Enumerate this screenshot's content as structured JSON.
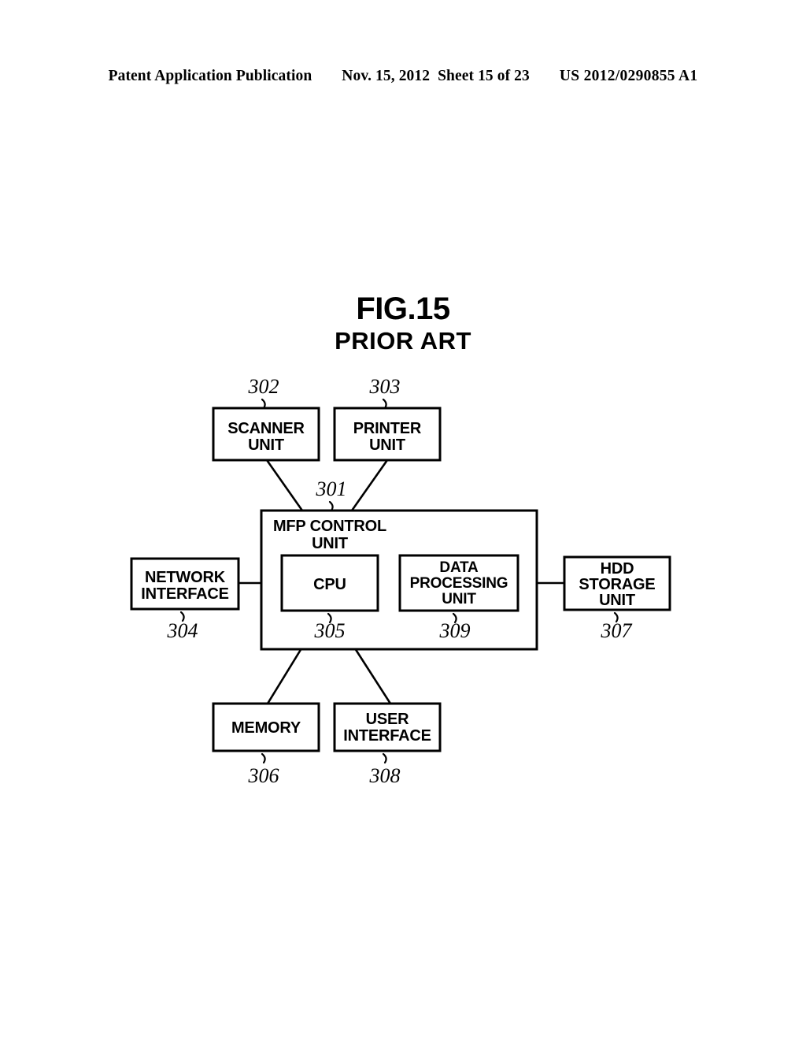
{
  "header": {
    "publication": "Patent Application Publication",
    "date": "Nov. 15, 2012",
    "sheet": "Sheet 15 of 23",
    "patent_number": "US 2012/0290855 A1"
  },
  "figure": {
    "title": "FIG.15",
    "subtitle": "PRIOR ART"
  },
  "diagram": {
    "type": "block-diagram",
    "blocks": {
      "scanner": {
        "ref": "302",
        "line1": "SCANNER",
        "line2": "UNIT"
      },
      "printer": {
        "ref": "303",
        "line1": "PRINTER",
        "line2": "UNIT"
      },
      "mfp": {
        "ref": "301",
        "line1": "MFP CONTROL",
        "line2": "UNIT"
      },
      "cpu": {
        "ref": "305",
        "line1": "CPU"
      },
      "dpu": {
        "ref": "309",
        "line1": "DATA",
        "line2": "PROCESSING",
        "line3": "UNIT"
      },
      "network": {
        "ref": "304",
        "line1": "NETWORK",
        "line2": "INTERFACE"
      },
      "hdd": {
        "ref": "307",
        "line1": "HDD",
        "line2": "STORAGE",
        "line3": "UNIT"
      },
      "memory": {
        "ref": "306",
        "line1": "MEMORY"
      },
      "userinterface": {
        "ref": "308",
        "line1": "USER",
        "line2": "INTERFACE"
      }
    },
    "colors": {
      "stroke": "#000000",
      "fill": "#ffffff"
    }
  }
}
